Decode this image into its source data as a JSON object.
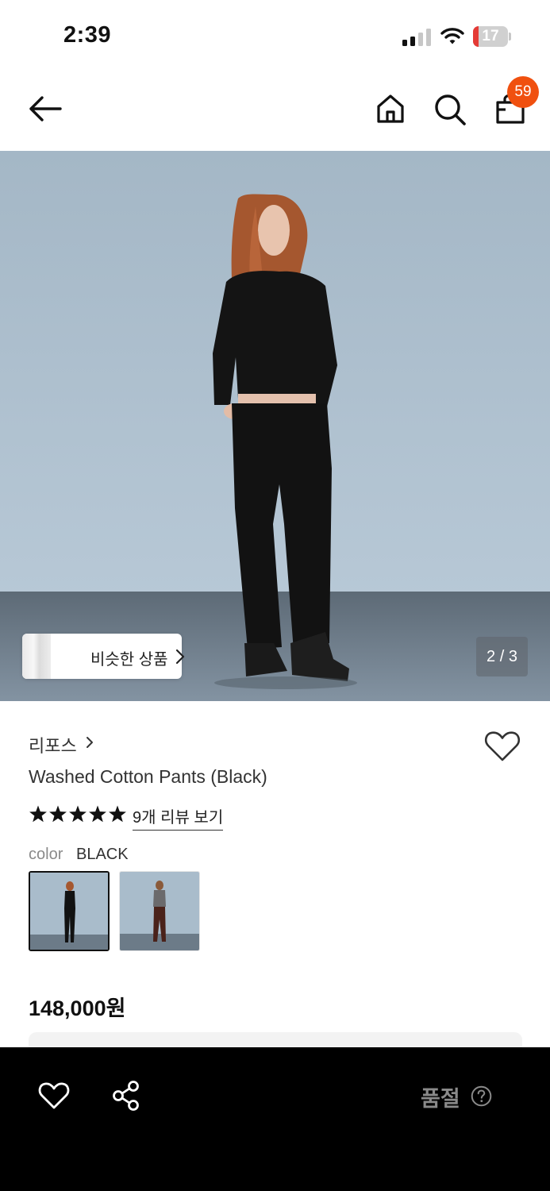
{
  "status_bar": {
    "time": "2:39",
    "battery_level": "17",
    "battery_fraction": 0.17,
    "signal_bars_active": 2,
    "signal_bars_total": 4
  },
  "nav": {
    "back_icon": "arrow-left-icon",
    "home_icon": "home-icon",
    "search_icon": "search-icon",
    "cart_icon": "shopping-bag-icon",
    "cart_count": "59"
  },
  "gallery": {
    "similar_button_label": "비슷한 상품",
    "page_indicator": "2 / 3"
  },
  "product": {
    "brand": "리포스",
    "title": "Washed Cotton Pants (Black)",
    "rating_stars": 5,
    "review_link": "9개 리뷰 보기",
    "color_label": "color",
    "color_value": "BLACK",
    "price": "148,000원"
  },
  "bottom_bar": {
    "wishlist_icon": "heart-outline-icon",
    "share_icon": "share-icon",
    "sold_out_label": "품절",
    "help_icon": "question-circle-icon"
  },
  "colors": {
    "badge": "#f0500f",
    "battery_low": "#e43b36",
    "bottom_bar": "#000000",
    "sold_out_text": "#8a8a8a"
  }
}
